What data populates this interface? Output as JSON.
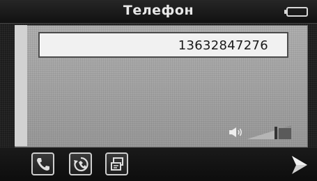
{
  "header": {
    "title": "Телефон",
    "battery_icon": "battery-icon"
  },
  "dialer": {
    "phone_number": "13632847276"
  },
  "volume": {
    "speaker_icon": "speaker-icon",
    "level_icon": "volume-level-icon"
  },
  "toolbar": {
    "buttons": [
      {
        "icon": "phone-handset-icon"
      },
      {
        "icon": "recent-calls-icon"
      },
      {
        "icon": "contacts-icon"
      }
    ],
    "next_icon": "arrow-right-icon"
  },
  "colors": {
    "panel": "#a6a6a6",
    "field": "#f1f1f1",
    "bar": "#141414",
    "icon": "#d8d8d8"
  }
}
